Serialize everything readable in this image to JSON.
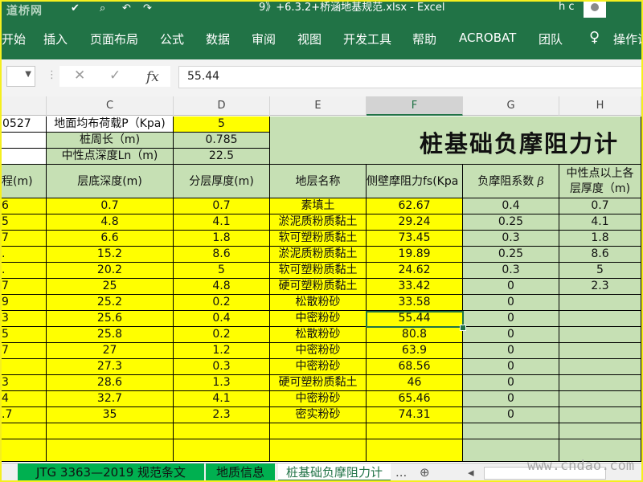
{
  "titlebar": {
    "logo_text": "道桥网",
    "doc_title": "9》+6.3.2+桥涵地基规范.xlsx  -  Excel",
    "user_name": "h c"
  },
  "ribbon": {
    "tabs": [
      "开始",
      "插入",
      "页面布局",
      "公式",
      "数据",
      "审阅",
      "视图",
      "开发工具",
      "帮助",
      "ACROBAT",
      "团队",
      "操作说"
    ]
  },
  "formula_bar": {
    "value": "55.44"
  },
  "colors": {
    "accent": "#217346",
    "yellow": "#ffff00",
    "green": "#c6e0b4",
    "tab_green": "#00b050"
  },
  "columns": [
    "C",
    "D",
    "E",
    "F",
    "G",
    "H"
  ],
  "selected_column": "F",
  "info": {
    "partial_b1": "0527",
    "label_load": "地面均布荷载P（Kpa)",
    "value_load": "5",
    "label_perimeter": "桩周长（m)",
    "value_perimeter": "0.785",
    "label_neutral": "中性点深度Ln（m)",
    "value_neutral": "22.5",
    "title": "桩基础负摩阻力计"
  },
  "headers": {
    "b": "程(m)",
    "c": "层底深度(m)",
    "d": "分层厚度(m)",
    "e": "地层名称",
    "f": "侧壁摩阻力fs(Kpa",
    "g": "负摩阻系数",
    "g_symbol": "β",
    "h_line1": "中性点以上各",
    "h_line2": "层厚度（m)"
  },
  "rows": [
    {
      "b": "6",
      "c": "0.7",
      "d": "0.7",
      "e": "素填土",
      "f": "62.67",
      "g": "0.4",
      "h": "0.7"
    },
    {
      "b": "5",
      "c": "4.8",
      "d": "4.1",
      "e": "淤泥质粉质黏土",
      "f": "29.24",
      "g": "0.25",
      "h": "4.1"
    },
    {
      "b": "7",
      "c": "6.6",
      "d": "1.8",
      "e": "软可塑粉质黏土",
      "f": "73.45",
      "g": "0.3",
      "h": "1.8"
    },
    {
      "b": ".",
      "c": "15.2",
      "d": "8.6",
      "e": "淤泥质粉质黏土",
      "f": "19.89",
      "g": "0.25",
      "h": "8.6"
    },
    {
      "b": ".",
      "c": "20.2",
      "d": "5",
      "e": "软可塑粉质黏土",
      "f": "24.62",
      "g": "0.3",
      "h": "5"
    },
    {
      "b": "7",
      "c": "25",
      "d": "4.8",
      "e": "硬可塑粉质黏土",
      "f": "33.42",
      "g": "0",
      "h": "2.3"
    },
    {
      "b": "9",
      "c": "25.2",
      "d": "0.2",
      "e": "松散粉砂",
      "f": "33.58",
      "g": "0",
      "h": ""
    },
    {
      "b": "3",
      "c": "25.6",
      "d": "0.4",
      "e": "中密粉砂",
      "f": "55.44",
      "g": "0",
      "h": ""
    },
    {
      "b": "5",
      "c": "25.8",
      "d": "0.2",
      "e": "松散粉砂",
      "f": "80.8",
      "g": "0",
      "h": ""
    },
    {
      "b": "7",
      "c": "27",
      "d": "1.2",
      "e": "中密粉砂",
      "f": "63.9",
      "g": "0",
      "h": ""
    },
    {
      "b": "",
      "c": "27.3",
      "d": "0.3",
      "e": "中密粉砂",
      "f": "68.56",
      "g": "0",
      "h": ""
    },
    {
      "b": "3",
      "c": "28.6",
      "d": "1.3",
      "e": "硬可塑粉质黏土",
      "f": "46",
      "g": "0",
      "h": ""
    },
    {
      "b": "4",
      "c": "32.7",
      "d": "4.1",
      "e": "中密粉砂",
      "f": "65.46",
      "g": "0",
      "h": ""
    },
    {
      "b": ".7",
      "c": "35",
      "d": "2.3",
      "e": "密实粉砂",
      "f": "74.31",
      "g": "0",
      "h": ""
    },
    {
      "b": "",
      "c": "",
      "d": "",
      "e": "",
      "f": "",
      "g": "",
      "h": ""
    },
    {
      "b": "",
      "c": "",
      "d": "",
      "e": "",
      "f": "",
      "g": "",
      "h": ""
    }
  ],
  "sheet_tabs": [
    "JTG 3363—2019 规范条文",
    "地质信息",
    "桩基础负摩阻力计"
  ],
  "active_sheet": "桩基础负摩阻力计",
  "sheet_nav": {
    "more": "...",
    "add": "⊕",
    "prev": "◂",
    "next": "▸"
  },
  "watermark": "www.cndao.com"
}
